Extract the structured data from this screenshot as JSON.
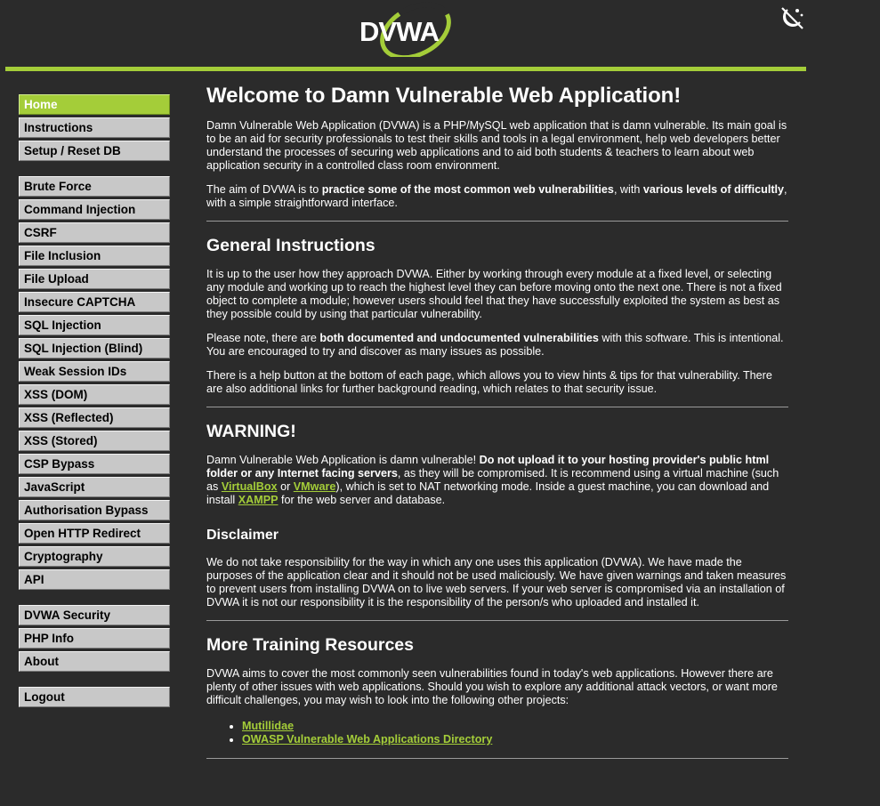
{
  "header": {
    "logo_text": "DVWA",
    "theme_toggle_icon": "theme-toggle-icon",
    "accent_color": "#a4cd39"
  },
  "sidebar": {
    "group1": [
      {
        "label": "Home",
        "selected": true
      },
      {
        "label": "Instructions"
      },
      {
        "label": "Setup / Reset DB"
      }
    ],
    "group2": [
      {
        "label": "Brute Force"
      },
      {
        "label": "Command Injection"
      },
      {
        "label": "CSRF"
      },
      {
        "label": "File Inclusion"
      },
      {
        "label": "File Upload"
      },
      {
        "label": "Insecure CAPTCHA"
      },
      {
        "label": "SQL Injection"
      },
      {
        "label": "SQL Injection (Blind)"
      },
      {
        "label": "Weak Session IDs"
      },
      {
        "label": "XSS (DOM)"
      },
      {
        "label": "XSS (Reflected)"
      },
      {
        "label": "XSS (Stored)"
      },
      {
        "label": "CSP Bypass"
      },
      {
        "label": "JavaScript"
      },
      {
        "label": "Authorisation Bypass"
      },
      {
        "label": "Open HTTP Redirect"
      },
      {
        "label": "Cryptography"
      },
      {
        "label": "API"
      }
    ],
    "group3": [
      {
        "label": "DVWA Security"
      },
      {
        "label": "PHP Info"
      },
      {
        "label": "About"
      }
    ],
    "group4": [
      {
        "label": "Logout"
      }
    ]
  },
  "main": {
    "title": "Welcome to Damn Vulnerable Web Application!",
    "intro": "Damn Vulnerable Web Application (DVWA) is a PHP/MySQL web application that is damn vulnerable. Its main goal is to be an aid for security professionals to test their skills and tools in a legal environment, help web developers better understand the processes of securing web applications and to aid both students & teachers to learn about web application security in a controlled class room environment.",
    "aim": {
      "part1": "The aim of DVWA is to ",
      "bold1": "practice some of the most common web vulnerabilities",
      "part2": ", with ",
      "bold2": "various levels of difficultly",
      "part3": ", with a simple straightforward interface."
    },
    "general": {
      "heading": "General Instructions",
      "p1": "It is up to the user how they approach DVWA. Either by working through every module at a fixed level, or selecting any module and working up to reach the highest level they can before moving onto the next one. There is not a fixed object to complete a module; however users should feel that they have successfully exploited the system as best as they possible could by using that particular vulnerability.",
      "p2_part1": "Please note, there are ",
      "p2_bold": "both documented and undocumented vulnerabilities",
      "p2_part2": " with this software. This is intentional. You are encouraged to try and discover as many issues as possible.",
      "p3": "There is a help button at the bottom of each page, which allows you to view hints & tips for that vulnerability. There are also additional links for further background reading, which relates to that security issue."
    },
    "warning": {
      "heading": "WARNING!",
      "part1": "Damn Vulnerable Web Application is damn vulnerable! ",
      "bold": "Do not upload it to your hosting provider's public html folder or any Internet facing servers",
      "part2": ", as they will be compromised. It is recommend using a virtual machine (such as ",
      "link_virtualbox": "VirtualBox",
      "part3": " or ",
      "link_vmware": "VMware",
      "part4": "), which is set to NAT networking mode. Inside a guest machine, you can download and install ",
      "link_xampp": "XAMPP",
      "part5": " for the web server and database."
    },
    "disclaimer": {
      "heading": "Disclaimer",
      "text": "We do not take responsibility for the way in which any one uses this application (DVWA). We have made the purposes of the application clear and it should not be used maliciously. We have given warnings and taken measures to prevent users from installing DVWA on to live web servers. If your web server is compromised via an installation of DVWA it is not our responsibility it is the responsibility of the person/s who uploaded and installed it."
    },
    "resources": {
      "heading": "More Training Resources",
      "text": "DVWA aims to cover the most commonly seen vulnerabilities found in today's web applications. However there are plenty of other issues with web applications. Should you wish to explore any additional attack vectors, or want more difficult challenges, you may wish to look into the following other projects:",
      "links": [
        "Mutillidae",
        "OWASP Vulnerable Web Applications Directory"
      ]
    }
  }
}
